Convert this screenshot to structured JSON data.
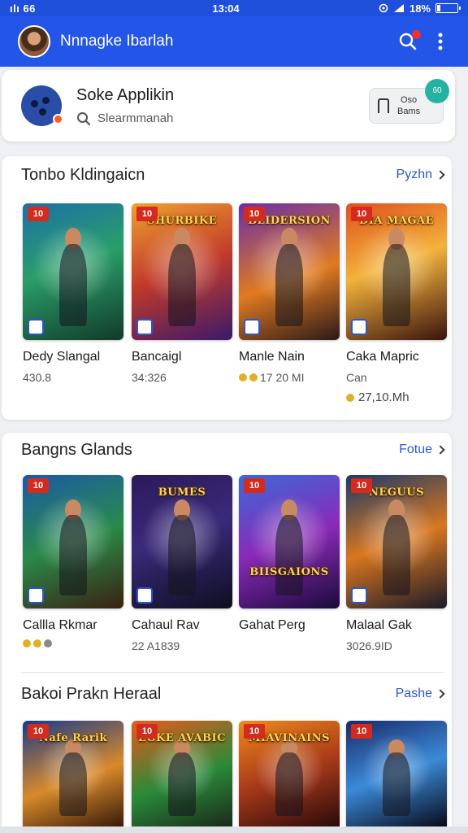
{
  "status_bar": {
    "left": "ılı 66",
    "time": "13:04",
    "battery": "18%",
    "battery_level": 0.18
  },
  "app_bar": {
    "title": "Nnnagke Ibarlah"
  },
  "app_card": {
    "name": "Soke Applikin",
    "subtitle": "Slearmmanah",
    "button_line1": "Oso",
    "button_line2": "Bams",
    "badge": "60"
  },
  "colors": {
    "primary": "#2356e8",
    "rank_badge": "#d52b1e",
    "link": "#2a56d6"
  },
  "icons": [
    "search-icon",
    "more-vert-icon",
    "chevron-right-icon",
    "coin-icon"
  ],
  "sections": [
    {
      "title": "Tonbo Kldingaicn",
      "link": "Pyzhn",
      "items": [
        {
          "rank": "10",
          "cover_title": "",
          "name": "Dedy Slangal",
          "meta": "430.8",
          "extra": ""
        },
        {
          "rank": "10",
          "cover_title": "SHURBIKE",
          "name": "Bancaigl",
          "meta": "34:326",
          "extra": ""
        },
        {
          "rank": "10",
          "cover_title": "BLIDERSION",
          "name": "Manle Nain",
          "meta": "17 20 MI",
          "extra": ""
        },
        {
          "rank": "10",
          "cover_title": "DIA MAGAE",
          "name": "Caka Mapric",
          "meta": "Can",
          "extra": "27,10.Mh"
        }
      ]
    },
    {
      "title": "Bangns Glands",
      "link": "Fotue",
      "items": [
        {
          "rank": "10",
          "cover_title": "",
          "name": "Callla Rkmar",
          "meta": "",
          "extra": ""
        },
        {
          "rank": "",
          "cover_title": "BUMES",
          "name": "Cahaul Rav",
          "meta": "22 A1839",
          "extra": ""
        },
        {
          "rank": "10",
          "cover_title": "BIISGAIONS",
          "name": "Gahat Perg",
          "meta": "",
          "extra": ""
        },
        {
          "rank": "10",
          "cover_title": "NEGUUS",
          "name": "Malaal Gak",
          "meta": "3026.9ID",
          "extra": ""
        }
      ]
    },
    {
      "title": "Bakoi Prakn Heraal",
      "link": "Pashe",
      "items": [
        {
          "rank": "10",
          "cover_title": "Nafe Rarik"
        },
        {
          "rank": "10",
          "cover_title": "EGKE AVABIC"
        },
        {
          "rank": "10",
          "cover_title": "MIAVINAINS"
        },
        {
          "rank": "10",
          "cover_title": ""
        }
      ]
    }
  ]
}
